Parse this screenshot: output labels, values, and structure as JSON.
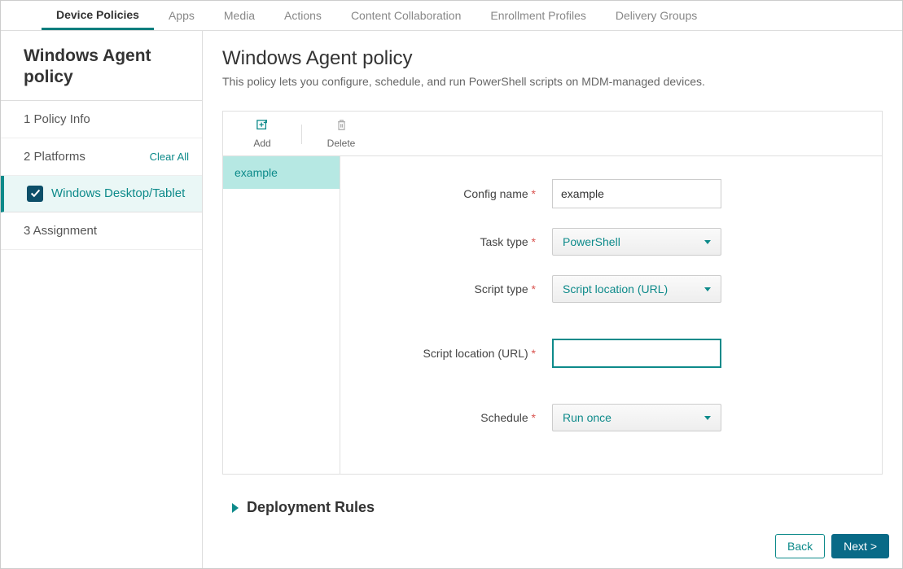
{
  "topTabs": {
    "devicePolicies": "Device Policies",
    "apps": "Apps",
    "media": "Media",
    "actions": "Actions",
    "contentCollab": "Content Collaboration",
    "enrollProfiles": "Enrollment Profiles",
    "deliveryGroups": "Delivery Groups"
  },
  "sidebar": {
    "title": "Windows Agent policy",
    "step1": "1  Policy Info",
    "step2": "2  Platforms",
    "clearAll": "Clear All",
    "platformItem": "Windows Desktop/Tablet",
    "step3": "3  Assignment"
  },
  "page": {
    "title": "Windows Agent policy",
    "desc": "This policy lets you configure, schedule, and run PowerShell scripts on MDM-managed devices."
  },
  "toolbar": {
    "add": "Add",
    "delete": "Delete"
  },
  "list": {
    "item1": "example"
  },
  "form": {
    "configNameLabel": "Config name",
    "configNameValue": "example",
    "taskTypeLabel": "Task type",
    "taskTypeValue": "PowerShell",
    "scriptTypeLabel": "Script type",
    "scriptTypeValue": "Script location (URL)",
    "scriptLocationLabel": "Script location (URL)",
    "scriptLocationValue": "",
    "scheduleLabel": "Schedule",
    "scheduleValue": "Run once"
  },
  "deployRules": "Deployment Rules",
  "buttons": {
    "back": "Back",
    "next": "Next >"
  }
}
